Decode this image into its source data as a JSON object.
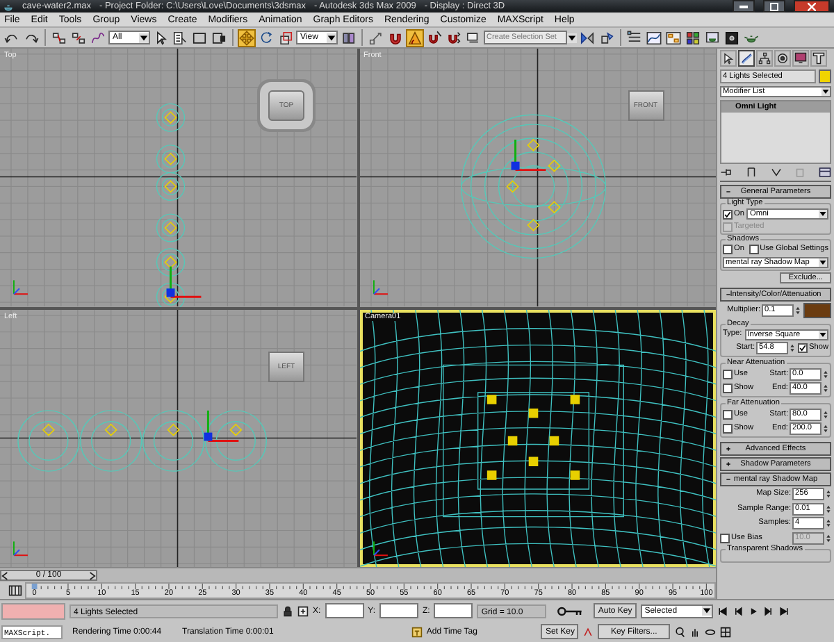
{
  "title_bar": {
    "file": "cave-water2.max",
    "project": "- Project Folder: C:\\Users\\Love\\Documents\\3dsmax",
    "app": "- Autodesk 3ds Max  2009",
    "display": "- Display : Direct 3D"
  },
  "menu": [
    "File",
    "Edit",
    "Tools",
    "Group",
    "Views",
    "Create",
    "Modifiers",
    "Animation",
    "Graph Editors",
    "Rendering",
    "Customize",
    "MAXScript",
    "Help"
  ],
  "toolbar": [
    {
      "kind": "undo",
      "selected": false
    },
    {
      "kind": "redo",
      "selected": false
    },
    {
      "kind": "sep"
    },
    {
      "kind": "link",
      "selected": false
    },
    {
      "kind": "unlink",
      "selected": false
    },
    {
      "kind": "bind",
      "selected": false
    },
    {
      "kind": "dropdown",
      "value": "All"
    },
    {
      "kind": "select",
      "selected": false
    },
    {
      "kind": "selectname",
      "selected": false
    },
    {
      "kind": "rect",
      "selected": false
    },
    {
      "kind": "window",
      "selected": false
    },
    {
      "kind": "sep"
    },
    {
      "kind": "move",
      "selected": true
    },
    {
      "kind": "rotate",
      "selected": false
    },
    {
      "kind": "scale",
      "selected": false
    },
    {
      "kind": "dropdown",
      "value": "View"
    },
    {
      "kind": "pivot",
      "selected": false
    },
    {
      "kind": "sep"
    },
    {
      "kind": "manipulate",
      "selected": false
    },
    {
      "kind": "snap",
      "selected": false
    },
    {
      "kind": "angle",
      "selected": true
    },
    {
      "kind": "percent",
      "selected": false
    },
    {
      "kind": "spinner",
      "selected": false
    },
    {
      "kind": "editsel",
      "selected": false
    },
    {
      "kind": "field",
      "placeholder": "Create Selection Set"
    },
    {
      "kind": "mirror",
      "selected": false
    },
    {
      "kind": "align",
      "selected": false
    },
    {
      "kind": "sep"
    },
    {
      "kind": "layers",
      "selected": false
    },
    {
      "kind": "curve",
      "selected": false
    },
    {
      "kind": "schematic",
      "selected": false
    },
    {
      "kind": "material",
      "selected": false
    },
    {
      "kind": "rendersetup",
      "selected": false
    },
    {
      "kind": "renderframe",
      "selected": false
    },
    {
      "kind": "teapot",
      "selected": false
    }
  ],
  "viewports": [
    {
      "label": "Top",
      "kind": "top",
      "active": false,
      "cube_label": "TOP"
    },
    {
      "label": "Front",
      "kind": "front",
      "active": false,
      "cube_label": "FRONT"
    },
    {
      "label": "Left",
      "kind": "left",
      "active": false,
      "cube_label": "LEFT"
    },
    {
      "label": "Camera01",
      "kind": "camera",
      "active": true
    }
  ],
  "time_slider": {
    "label": "0 / 100",
    "level": 0
  },
  "ruler_labels": [
    "0",
    "5",
    "10",
    "15",
    "20",
    "25",
    "30",
    "35",
    "40",
    "45",
    "50",
    "55",
    "60",
    "65",
    "70",
    "75",
    "80",
    "85",
    "90",
    "95",
    "100"
  ],
  "panel": {
    "tabs": [
      {
        "kind": "create",
        "selected": false
      },
      {
        "kind": "modify",
        "selected": true
      },
      {
        "kind": "hierarchy",
        "selected": false
      },
      {
        "kind": "motion",
        "selected": false
      },
      {
        "kind": "display",
        "selected": false
      },
      {
        "kind": "utilities",
        "selected": false
      }
    ],
    "name_field": "4 Lights Selected",
    "modifier_list": "Modifier List",
    "stack": [
      {
        "label": "Omni Light",
        "selected": true
      }
    ],
    "rollouts": [
      {
        "title": "General Parameters",
        "expanded": true,
        "rows": [
          {
            "kind": "group",
            "label": "Light Type",
            "rows": [
              {
                "kind": "line",
                "items": [
                  {
                    "kind": "check",
                    "label": "On",
                    "checked": true,
                    "disabled": false
                  },
                  {
                    "kind": "dropdown",
                    "value": "Omni"
                  }
                ]
              },
              {
                "kind": "check",
                "label": "Targeted",
                "checked": false,
                "disabled": true
              }
            ]
          },
          {
            "kind": "group",
            "label": "Shadows",
            "rows": [
              {
                "kind": "line",
                "items": [
                  {
                    "kind": "check",
                    "label": "On",
                    "checked": false,
                    "disabled": false
                  },
                  {
                    "kind": "check",
                    "label": "Use Global Settings",
                    "checked": false,
                    "disabled": false
                  }
                ]
              },
              {
                "kind": "dropdown",
                "value": "mental ray Shadow Map"
              }
            ]
          },
          {
            "kind": "button",
            "label": "Exclude..."
          }
        ]
      },
      {
        "title": "Intensity/Color/Attenuation",
        "expanded": true,
        "rows": [
          {
            "kind": "line",
            "items": [
              {
                "kind": "spinner",
                "label": "Multiplier:",
                "value": "0.1",
                "disabled": false
              },
              {
                "kind": "color",
                "color": "#6b3c10"
              }
            ]
          },
          {
            "kind": "group",
            "label": "Decay",
            "rows": [
              {
                "kind": "line",
                "items": [
                  {
                    "kind": "label",
                    "label": "Type:"
                  },
                  {
                    "kind": "dropdown",
                    "value": "Inverse Square"
                  }
                ]
              },
              {
                "kind": "line",
                "items": [
                  {
                    "kind": "spinner",
                    "label": "Start:",
                    "value": "54.8",
                    "disabled": false
                  },
                  {
                    "kind": "check",
                    "label": "Show",
                    "checked": true,
                    "disabled": false
                  }
                ]
              }
            ]
          },
          {
            "kind": "group",
            "label": "Near Attenuation",
            "rows": [
              {
                "kind": "line",
                "items": [
                  {
                    "kind": "check",
                    "label": "Use",
                    "checked": false,
                    "disabled": false
                  },
                  {
                    "kind": "spinner",
                    "label": "Start:",
                    "value": "0.0",
                    "disabled": false
                  }
                ]
              },
              {
                "kind": "line",
                "items": [
                  {
                    "kind": "check",
                    "label": "Show",
                    "checked": false,
                    "disabled": false
                  },
                  {
                    "kind": "spinner",
                    "label": "End:",
                    "value": "40.0",
                    "disabled": false
                  }
                ]
              }
            ]
          },
          {
            "kind": "group",
            "label": "Far Attenuation",
            "rows": [
              {
                "kind": "line",
                "items": [
                  {
                    "kind": "check",
                    "label": "Use",
                    "checked": false,
                    "disabled": false
                  },
                  {
                    "kind": "spinner",
                    "label": "Start:",
                    "value": "80.0",
                    "disabled": false
                  }
                ]
              },
              {
                "kind": "line",
                "items": [
                  {
                    "kind": "check",
                    "label": "Show",
                    "checked": false,
                    "disabled": false
                  },
                  {
                    "kind": "spinner",
                    "label": "End:",
                    "value": "200.0",
                    "disabled": false
                  }
                ]
              }
            ]
          }
        ]
      },
      {
        "title": "Advanced Effects",
        "expanded": false
      },
      {
        "title": "Shadow Parameters",
        "expanded": false
      },
      {
        "title": "mental ray Shadow Map",
        "expanded": true,
        "rows": [
          {
            "kind": "spinner",
            "label": "Map Size:",
            "value": "256",
            "disabled": false
          },
          {
            "kind": "spinner",
            "label": "Sample Range:",
            "value": "0.01",
            "disabled": false
          },
          {
            "kind": "spinner",
            "label": "Samples:",
            "value": "4",
            "disabled": false
          },
          {
            "kind": "line",
            "items": [
              {
                "kind": "check",
                "label": "Use Bias",
                "checked": false,
                "disabled": false
              },
              {
                "kind": "spinner",
                "value": "10.0",
                "disabled": true
              }
            ]
          },
          {
            "kind": "group",
            "label": "Transparent Shadows",
            "rows": []
          }
        ]
      }
    ]
  },
  "status": {
    "script_field": "MAXScript.",
    "prompt": "4 Lights Selected",
    "x_label": "X:",
    "y_label": "Y:",
    "z_label": "Z:",
    "grid": "Grid = 10.0",
    "rendering_time": "Rendering Time  0:00:44",
    "translation_time": "Translation Time  0:00:01",
    "time_tag": "Add Time Tag",
    "auto_key": "Auto Key",
    "key_mode": "Selected",
    "set_key": "Set Key",
    "key_filters": "Key Filters..."
  }
}
